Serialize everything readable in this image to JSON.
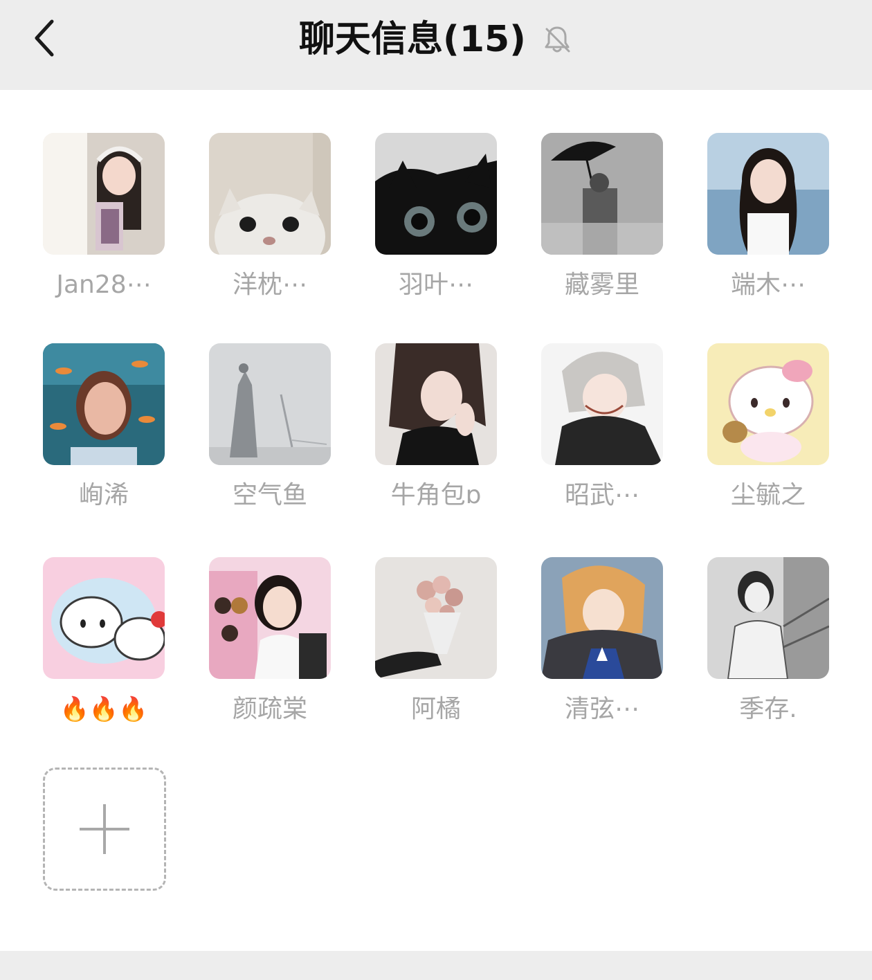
{
  "header": {
    "title": "聊天信息(15)",
    "back_icon": "chevron-left-icon",
    "mute_icon": "bell-off-icon"
  },
  "members": [
    {
      "name": "Jan28⋯",
      "avatar": "girl-headphones"
    },
    {
      "name": "洋枕⋯",
      "avatar": "white-cat"
    },
    {
      "name": "羽叶⋯",
      "avatar": "black-cat"
    },
    {
      "name": "藏雾里",
      "avatar": "umbrella-fog"
    },
    {
      "name": "端木⋯",
      "avatar": "girl-sea"
    },
    {
      "name": "峋浠",
      "avatar": "underwater-girl"
    },
    {
      "name": "空气鱼",
      "avatar": "rain-silhouette"
    },
    {
      "name": "牛角包ɒ",
      "avatar": "anime-girl-dark"
    },
    {
      "name": "昭武⋯",
      "avatar": "anime-boy-white-hair"
    },
    {
      "name": "尘毓之",
      "avatar": "hello-kitty"
    },
    {
      "name": "🔥🔥🔥",
      "avatar": "hello-kitty-pair"
    },
    {
      "name": "颜疏棠",
      "avatar": "girl-anime-poster"
    },
    {
      "name": "阿橘",
      "avatar": "rose-bouquet"
    },
    {
      "name": "清弦⋯",
      "avatar": "anime-boy-lily"
    },
    {
      "name": "季存.",
      "avatar": "sketch-girl"
    }
  ],
  "add_button": {
    "icon": "plus-icon"
  },
  "colors": {
    "header_bg": "#ededed",
    "name_text": "#a6a6a6",
    "title_text": "#111111"
  }
}
